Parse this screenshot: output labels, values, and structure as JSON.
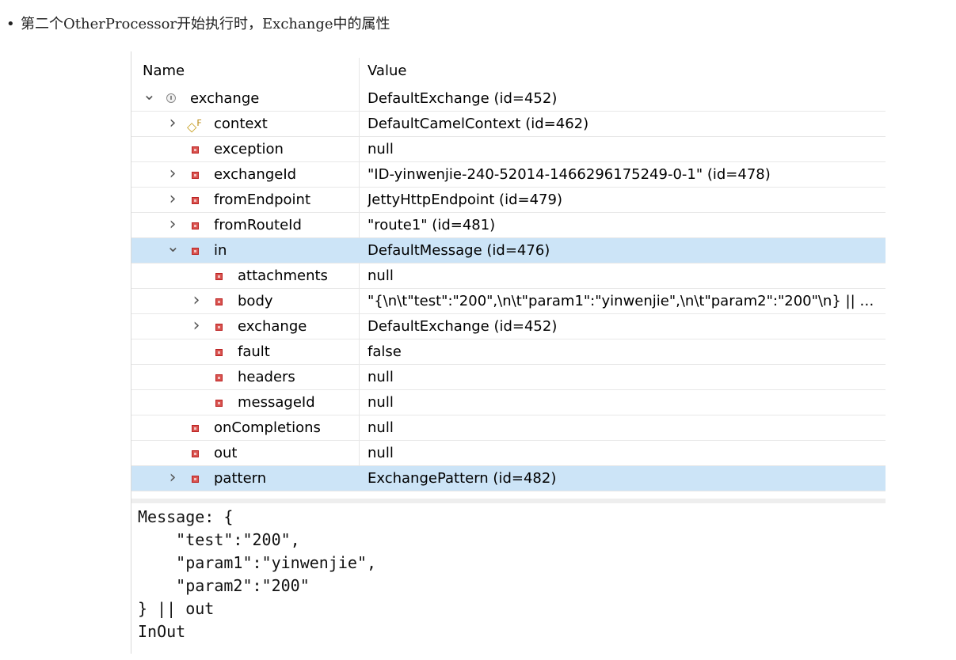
{
  "caption": "第二个OtherProcessor开始执行时，Exchange中的属性",
  "columns": {
    "name": "Name",
    "value": "Value"
  },
  "rows": [
    {
      "name": "exchange",
      "value": "DefaultExchange  (id=452)",
      "indent": 0,
      "expander": "expanded",
      "icon": "object-icon"
    },
    {
      "name": "context",
      "value": "DefaultCamelContext  (id=462)",
      "indent": 1,
      "expander": "collapsed",
      "icon": "final-field-icon"
    },
    {
      "name": "exception",
      "value": "null",
      "indent": 1,
      "expander": "none",
      "icon": "private-field-icon"
    },
    {
      "name": "exchangeId",
      "value": "\"ID-yinwenjie-240-52014-1466296175249-0-1\" (id=478)",
      "indent": 1,
      "expander": "collapsed",
      "icon": "private-field-icon"
    },
    {
      "name": "fromEndpoint",
      "value": "JettyHttpEndpoint  (id=479)",
      "indent": 1,
      "expander": "collapsed",
      "icon": "private-field-icon"
    },
    {
      "name": "fromRouteId",
      "value": "\"route1\" (id=481)",
      "indent": 1,
      "expander": "collapsed",
      "icon": "private-field-icon"
    },
    {
      "name": "in",
      "value": "DefaultMessage  (id=476)",
      "indent": 1,
      "expander": "expanded",
      "icon": "private-field-icon",
      "selected": true
    },
    {
      "name": "attachments",
      "value": "null",
      "indent": 2,
      "expander": "none",
      "icon": "private-field-icon"
    },
    {
      "name": "body",
      "value": "\"{\\n\\t\"test\":\"200\",\\n\\t\"param1\":\"yinwenjie\",\\n\\t\"param2\":\"200\"\\n} || ou...",
      "indent": 2,
      "expander": "collapsed",
      "icon": "private-field-icon"
    },
    {
      "name": "exchange",
      "value": "DefaultExchange  (id=452)",
      "indent": 2,
      "expander": "collapsed",
      "icon": "private-field-icon"
    },
    {
      "name": "fault",
      "value": "false",
      "indent": 2,
      "expander": "none",
      "icon": "private-field-icon"
    },
    {
      "name": "headers",
      "value": "null",
      "indent": 2,
      "expander": "none",
      "icon": "private-field-icon"
    },
    {
      "name": "messageId",
      "value": "null",
      "indent": 2,
      "expander": "none",
      "icon": "private-field-icon"
    },
    {
      "name": "onCompletions",
      "value": "null",
      "indent": 1,
      "expander": "none",
      "icon": "private-field-icon"
    },
    {
      "name": "out",
      "value": "null",
      "indent": 1,
      "expander": "none",
      "icon": "private-field-icon"
    },
    {
      "name": "pattern",
      "value": "ExchangePattern  (id=482)",
      "indent": 1,
      "expander": "collapsed",
      "icon": "private-field-icon",
      "selected": true
    }
  ],
  "detail_text": "Message: {\n    \"test\":\"200\",\n    \"param1\":\"yinwenjie\",\n    \"param2\":\"200\"\n} || out\nInOut",
  "colors": {
    "selected_row": "#cce4f7",
    "field_icon": "#d9534f"
  }
}
